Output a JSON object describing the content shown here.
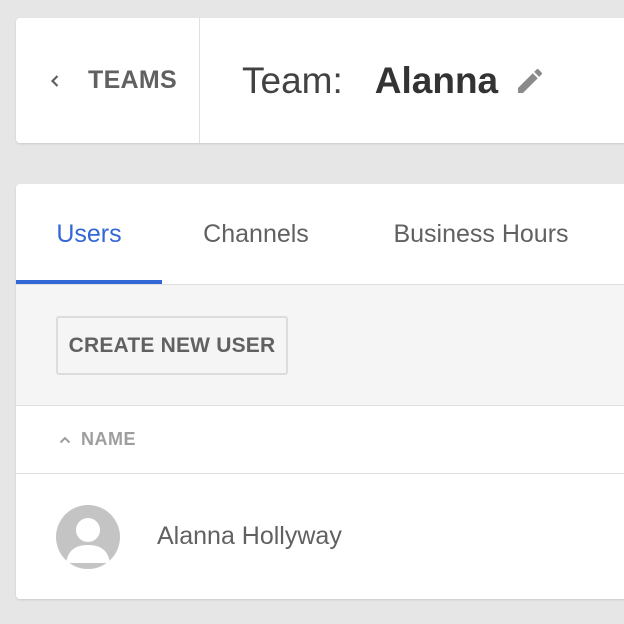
{
  "header": {
    "back_label": "TEAMS",
    "team_prefix": "Team:",
    "team_name": "Alanna"
  },
  "tabs": [
    {
      "label": "Users",
      "active": true
    },
    {
      "label": "Channels",
      "active": false
    },
    {
      "label": "Business Hours",
      "active": false
    }
  ],
  "toolbar": {
    "create_label": "CREATE NEW USER"
  },
  "table": {
    "column_header": "NAME",
    "sort": "ascending",
    "rows": [
      {
        "name": "Alanna Hollyway"
      }
    ]
  },
  "colors": {
    "accent": "#3367d6",
    "background": "#e6e6e6",
    "card": "#ffffff",
    "toolbar": "#f5f5f5"
  }
}
